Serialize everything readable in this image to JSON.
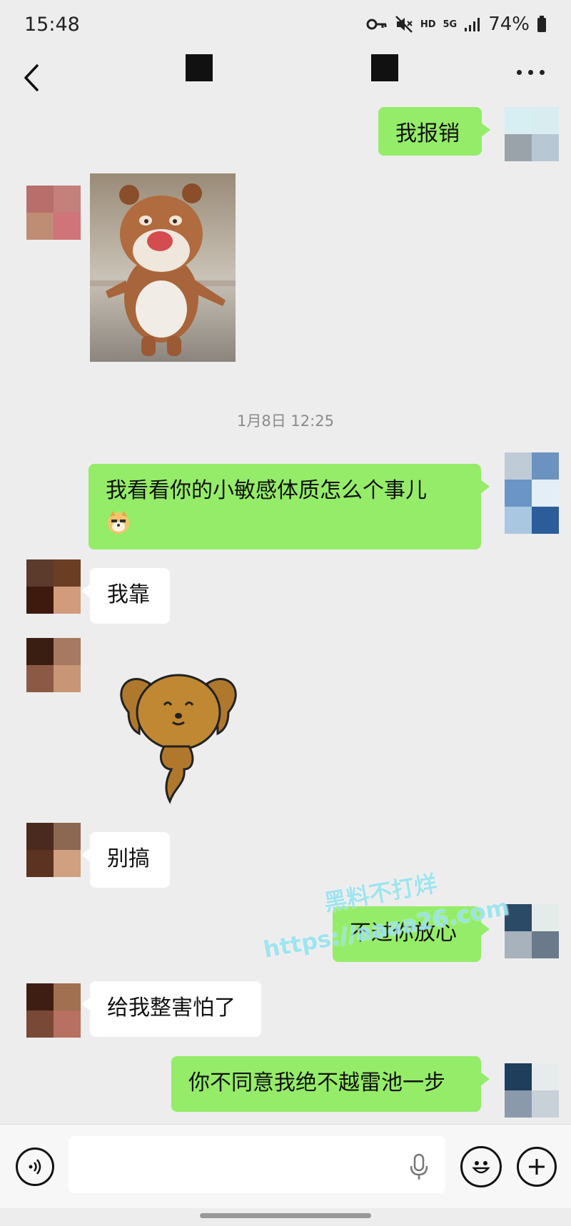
{
  "status_bar": {
    "time": "15:48",
    "hd": "HD",
    "network": "5G",
    "battery": "74%",
    "icons": [
      "key-icon",
      "mute-icon",
      "signal-icon",
      "battery-icon"
    ]
  },
  "nav": {
    "back_icon": "back-chevron-icon",
    "more_icon": "more-dots-icon"
  },
  "messages": [
    {
      "id": "m1",
      "side": "out",
      "type": "text",
      "text": "我报销"
    },
    {
      "id": "m2",
      "side": "in",
      "type": "image",
      "icon": "bear-photo"
    },
    {
      "id": "m3",
      "type": "timestamp",
      "text": "1月8日 12:25"
    },
    {
      "id": "m4",
      "side": "out",
      "type": "text",
      "text": "我看看你的小敏感体质怎么个事儿",
      "emoji": "doge-emoji"
    },
    {
      "id": "m5",
      "side": "in",
      "type": "text",
      "text": "我靠"
    },
    {
      "id": "m6",
      "side": "in",
      "type": "sticker",
      "icon": "dog-sticker"
    },
    {
      "id": "m7",
      "side": "in",
      "type": "text",
      "text": "别搞"
    },
    {
      "id": "m8",
      "side": "out",
      "type": "text",
      "text": "不过你放心"
    },
    {
      "id": "m9",
      "side": "in",
      "type": "text",
      "text": "给我整害怕了"
    },
    {
      "id": "m10",
      "side": "out",
      "type": "text",
      "text": "你不同意我绝不越雷池一步"
    }
  ],
  "watermark": {
    "line1": "黑料不打烊",
    "line2": "https://aaaa26.com"
  },
  "input_bar": {
    "icons": [
      "voice-icon",
      "microphone-icon",
      "emoji-icon",
      "plus-icon"
    ],
    "value": ""
  },
  "colors": {
    "background": "#ededed",
    "outgoing_bubble": "#95ec69",
    "incoming_bubble": "#ffffff"
  }
}
